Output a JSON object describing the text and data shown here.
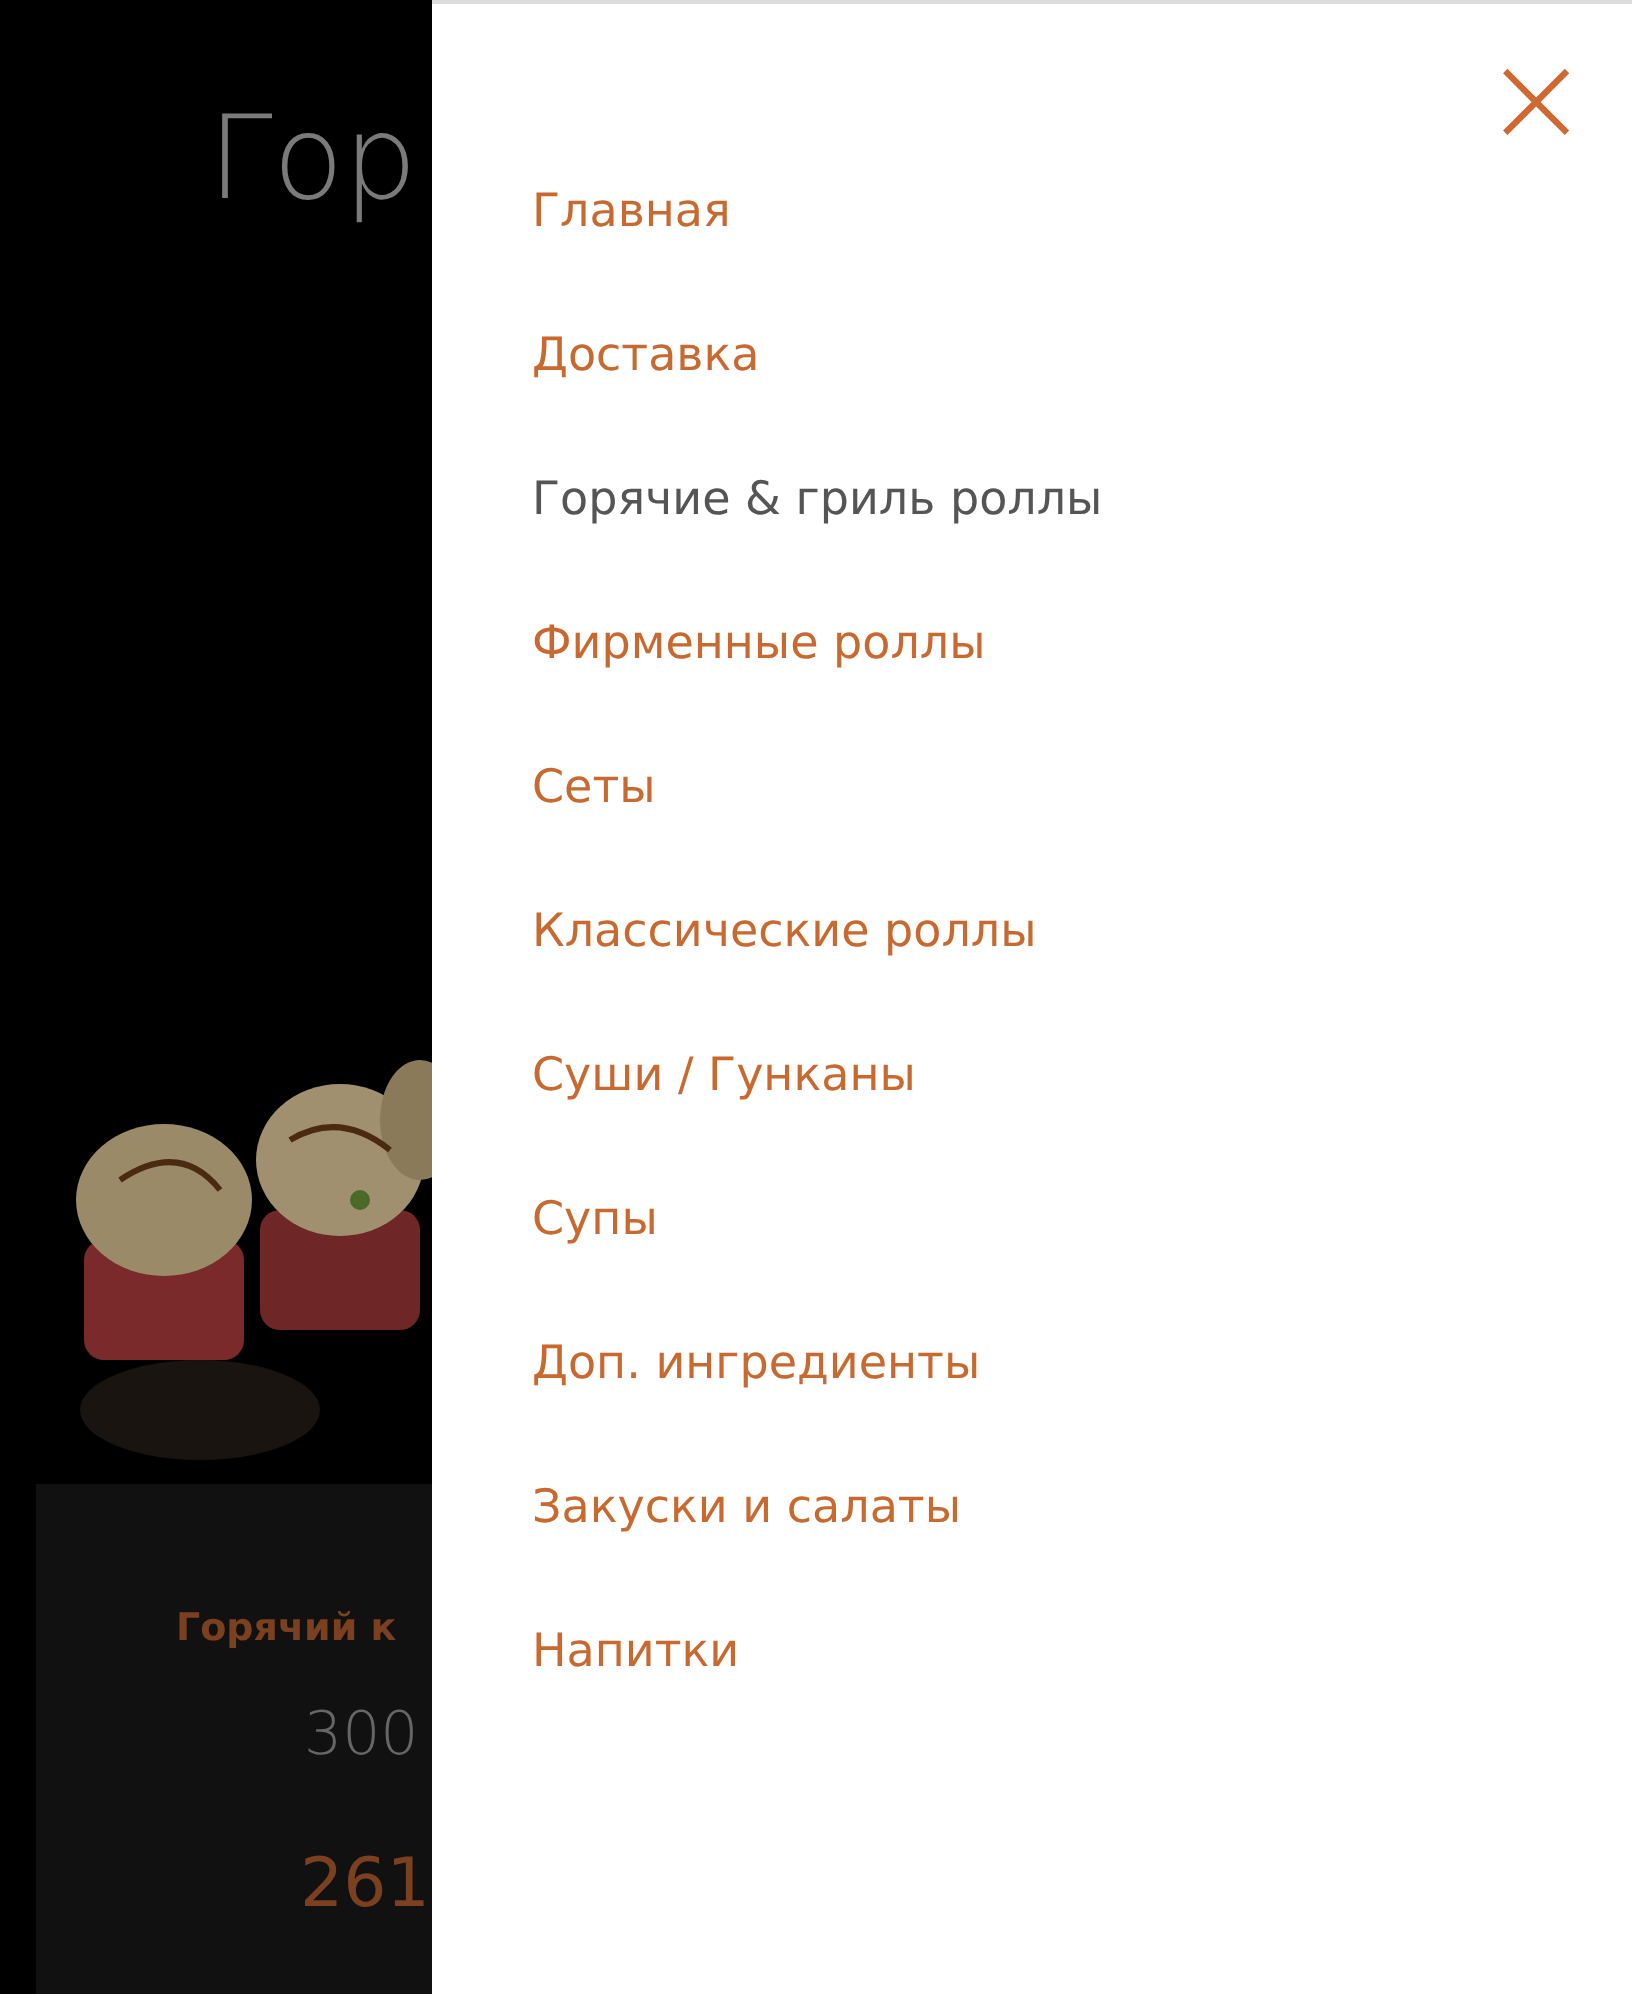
{
  "page": {
    "heading": "Гор",
    "product": {
      "name": "Горячий к",
      "weight": "300",
      "price": "261"
    }
  },
  "menu": {
    "close": "×",
    "items": [
      {
        "label": "Главная",
        "selected": false
      },
      {
        "label": "Доставка",
        "selected": false
      },
      {
        "label": "Горячие & гриль роллы",
        "selected": true
      },
      {
        "label": "Фирменные роллы",
        "selected": false
      },
      {
        "label": "Сеты",
        "selected": false
      },
      {
        "label": "Классические роллы",
        "selected": false
      },
      {
        "label": "Суши / Гунканы",
        "selected": false
      },
      {
        "label": "Супы",
        "selected": false
      },
      {
        "label": "Доп. ингредиенты",
        "selected": false
      },
      {
        "label": "Закуски и салаты",
        "selected": false
      },
      {
        "label": "Напитки",
        "selected": false
      }
    ]
  }
}
